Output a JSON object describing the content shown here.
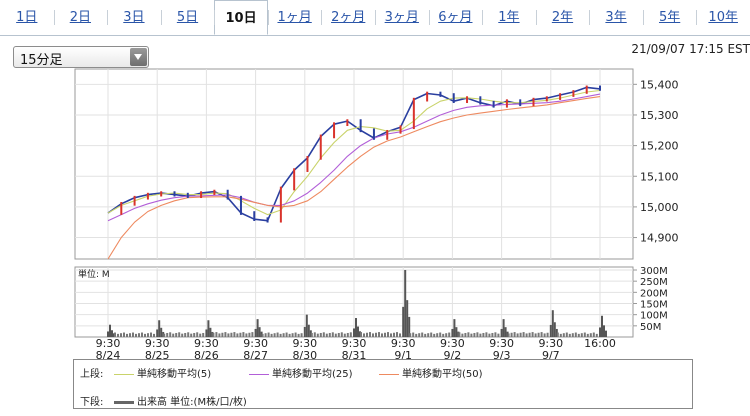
{
  "tabs": [
    "1日",
    "2日",
    "3日",
    "5日",
    "10日",
    "1ヶ月",
    "2ヶ月",
    "3ヶ月",
    "6ヶ月",
    "1年",
    "2年",
    "3年",
    "5年",
    "10年"
  ],
  "active_tab": "10日",
  "interval_select": {
    "value": "15分足",
    "icon": "chevron-down-icon"
  },
  "timestamp": "21/09/07 17:15 EST",
  "price_axis": {
    "ticks": [
      "15,400",
      "15,300",
      "15,200",
      "15,100",
      "15,000",
      "14,900"
    ],
    "values": [
      15400,
      15300,
      15200,
      15100,
      15000,
      14900
    ],
    "ylim": [
      14830,
      15450
    ]
  },
  "volume_axis": {
    "label": "単位: M",
    "ticks": [
      "300M",
      "250M",
      "200M",
      "150M",
      "100M",
      "50M"
    ],
    "values": [
      300,
      250,
      200,
      150,
      100,
      50
    ],
    "ylim": [
      0,
      300
    ]
  },
  "x_axis": [
    {
      "time": "9:30",
      "date": "8/24"
    },
    {
      "time": "9:30",
      "date": "8/25"
    },
    {
      "time": "9:30",
      "date": "8/26"
    },
    {
      "time": "9:30",
      "date": "8/27"
    },
    {
      "time": "9:30",
      "date": "8/30"
    },
    {
      "time": "9:30",
      "date": "8/31"
    },
    {
      "time": "9:30",
      "date": "9/1"
    },
    {
      "time": "9:30",
      "date": "9/2"
    },
    {
      "time": "9:30",
      "date": "9/3"
    },
    {
      "time": "9:30",
      "date": "9/7"
    },
    {
      "time": "16:00",
      "date": ""
    }
  ],
  "legend": {
    "upper_label": "上段:",
    "lower_label": "下段:",
    "items": [
      {
        "label": "単純移動平均(5)",
        "color": "#c9d36a"
      },
      {
        "label": "単純移動平均(25)",
        "color": "#b25fd8"
      },
      {
        "label": "単純移動平均(50)",
        "color": "#ee8a60"
      }
    ],
    "volume_item": {
      "label": "出来高 単位:(M株/口/枚)",
      "color": "#666666"
    }
  },
  "chart_data": {
    "type": "line",
    "series": [
      {
        "values": [
          14980,
          15010,
          15030,
          15040,
          15045,
          15040,
          15035,
          15045,
          15050,
          15030,
          14980,
          14960,
          14955,
          15060,
          15120,
          15160,
          15230,
          15270,
          15280,
          15250,
          15225,
          15245,
          15260,
          15350,
          15370,
          15365,
          15345,
          15355,
          15340,
          15330,
          15345,
          15335,
          15350,
          15355,
          15365,
          15375,
          15390,
          15385
        ]
      },
      {
        "values": [
          14980,
          15005,
          15020,
          15035,
          15042,
          15045,
          15040,
          15040,
          15045,
          15043,
          15020,
          14995,
          14975,
          14990,
          15050,
          15100,
          15160,
          15210,
          15250,
          15262,
          15258,
          15247,
          15250,
          15280,
          15320,
          15345,
          15355,
          15356,
          15352,
          15345,
          15340,
          15340,
          15344,
          15348,
          15355,
          15365,
          15375,
          15380
        ]
      },
      {
        "values": [
          14955,
          14975,
          14995,
          15010,
          15022,
          15030,
          15035,
          15036,
          15038,
          15039,
          15030,
          15015,
          15005,
          15005,
          15020,
          15045,
          15080,
          15120,
          15165,
          15200,
          15225,
          15238,
          15245,
          15260,
          15280,
          15300,
          15315,
          15325,
          15330,
          15332,
          15334,
          15336,
          15338,
          15340,
          15345,
          15352,
          15360,
          15368
        ]
      },
      {
        "values": [
          14830,
          14900,
          14950,
          14985,
          15005,
          15020,
          15030,
          15032,
          15033,
          15033,
          15025,
          15015,
          15005,
          15000,
          15005,
          15020,
          15050,
          15090,
          15130,
          15165,
          15195,
          15215,
          15228,
          15245,
          15262,
          15278,
          15290,
          15300,
          15306,
          15312,
          15318,
          15323,
          15328,
          15333,
          15340,
          15347,
          15354,
          15360
        ]
      }
    ],
    "volume_spikes": [
      55,
      75,
      75,
      80,
      100,
      85,
      300,
      80,
      80,
      120,
      95
    ],
    "ylim": [
      14830,
      15450
    ]
  }
}
